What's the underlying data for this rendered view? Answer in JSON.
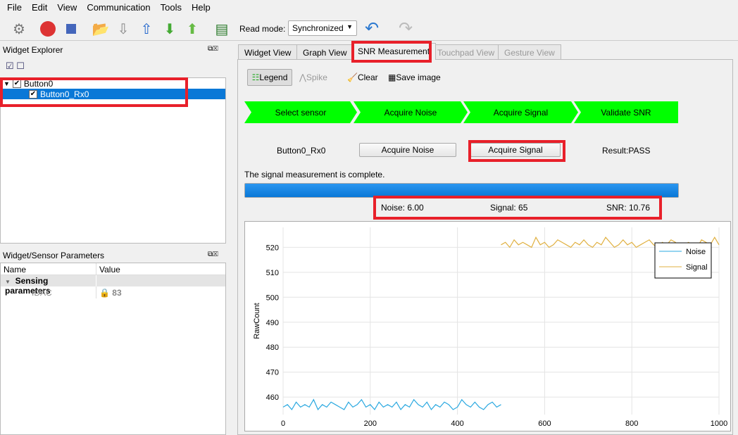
{
  "menu": [
    "File",
    "Edit",
    "View",
    "Communication",
    "Tools",
    "Help"
  ],
  "toolbar": {
    "read_mode_label": "Read mode:",
    "read_mode_value": "Synchronized"
  },
  "widget_explorer": {
    "title": "Widget Explorer",
    "items": [
      {
        "label": "Button0",
        "checked": true
      },
      {
        "label": "Button0_Rx0",
        "checked": true,
        "selected": true
      }
    ]
  },
  "params": {
    "title": "Widget/Sensor Parameters",
    "col_name": "Name",
    "col_value": "Value",
    "group": "Sensing parameters",
    "rows": [
      {
        "name": "IDAC",
        "value": "83",
        "locked": true
      }
    ]
  },
  "tabs": [
    {
      "label": "Widget View"
    },
    {
      "label": "Graph View"
    },
    {
      "label": "SNR Measurement",
      "active": true
    },
    {
      "label": "Touchpad View",
      "disabled": true
    },
    {
      "label": "Gesture View",
      "disabled": true
    }
  ],
  "snr_toolbar": {
    "legend": "Legend",
    "spike": "Spike",
    "clear": "Clear",
    "save": "Save image"
  },
  "steps": [
    "Select sensor",
    "Acquire Noise",
    "Acquire Signal",
    "Validate SNR"
  ],
  "sensor": "Button0_Rx0",
  "acquire_noise": "Acquire Noise",
  "acquire_signal": "Acquire Signal",
  "result": "Result:PASS",
  "status": "The signal measurement is complete.",
  "progress_percent": 100,
  "noise": "Noise:  6.00",
  "signal": "Signal:  65",
  "snr": "SNR:  10.76",
  "colors": {
    "accent": "#0a84e0",
    "step": "#00ff00",
    "highlight": "#e8202a",
    "noise": "#29a8e0",
    "signal": "#e0b040"
  },
  "chart_data": {
    "type": "line",
    "ylabel": "RawCount",
    "xlim": [
      0,
      1000
    ],
    "ylim": [
      453,
      528
    ],
    "xticks": [
      0,
      200,
      400,
      600,
      800,
      1000
    ],
    "yticks": [
      460,
      470,
      480,
      490,
      500,
      510,
      520
    ],
    "grid": true,
    "legend": "top-right",
    "series": [
      {
        "name": "Noise",
        "x_start": 0,
        "x_step": 10,
        "values": [
          456,
          457,
          455,
          458,
          456,
          457,
          456,
          459,
          455,
          457,
          456,
          458,
          457,
          456,
          455,
          458,
          456,
          457,
          459,
          456,
          457,
          455,
          458,
          456,
          457,
          456,
          458,
          455,
          457,
          456,
          459,
          457,
          456,
          458,
          455,
          457,
          456,
          458,
          457,
          455,
          456,
          459,
          457,
          456,
          458,
          456,
          455,
          457,
          458,
          456,
          457
        ]
      },
      {
        "name": "Signal",
        "x_start": 500,
        "x_step": 10,
        "values": [
          521,
          522,
          520,
          523,
          521,
          522,
          521,
          520,
          524,
          521,
          522,
          520,
          521,
          523,
          522,
          521,
          520,
          522,
          521,
          523,
          521,
          520,
          522,
          521,
          524,
          522,
          520,
          521,
          523,
          521,
          522,
          520,
          521,
          522,
          523,
          521,
          520,
          522,
          521,
          523,
          522,
          520,
          521,
          522,
          521,
          520,
          523,
          522,
          521,
          524,
          521
        ]
      }
    ]
  }
}
